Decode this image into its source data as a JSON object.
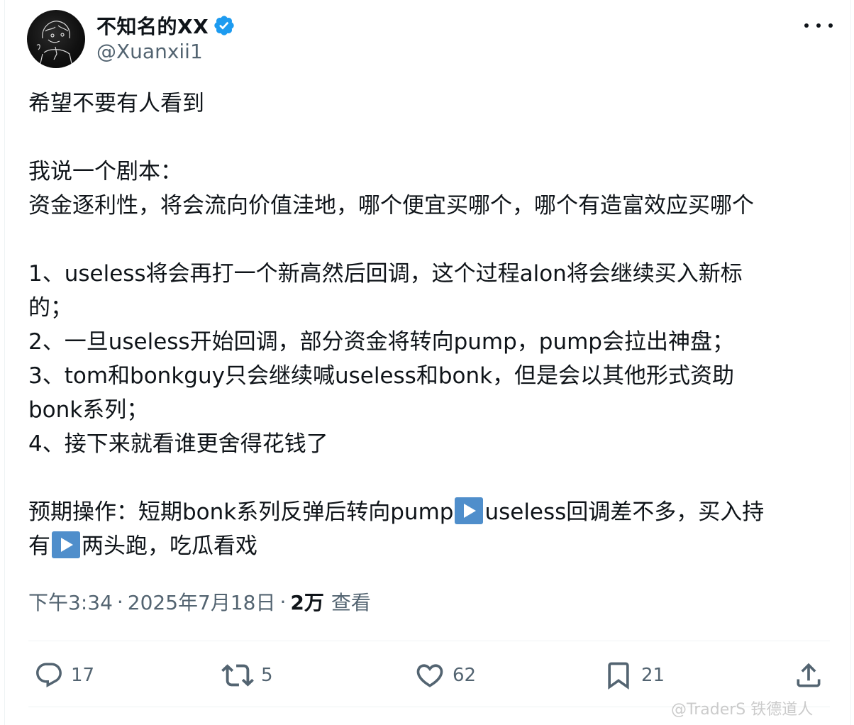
{
  "author": {
    "display_name": "不知名的XX",
    "handle": "@Xuanxii1",
    "verified": true
  },
  "tweet": {
    "lines": [
      "希望不要有人看到",
      "",
      "我说一个剧本：",
      "资金逐利性，将会流向价值洼地，哪个便宜买哪个，哪个有造富效应买哪个",
      "",
      "1、useless将会再打一个新高然后回调，这个过程alon将会继续买入新标",
      "的；",
      "2、一旦useless开始回调，部分资金将转向pump，pump会拉出神盘；",
      "3、tom和bonkguy只会继续喊useless和bonk，但是会以其他形式资助",
      "bonk系列；",
      "4、接下来就看谁更舍得花钱了",
      ""
    ],
    "plan_line1_a": "预期操作：短期bonk系列反弹后转向pump",
    "plan_line1_b": "useless回调差不多，买入持",
    "plan_line2_a": "有",
    "plan_line2_b": "两头跑，吃瓜看戏"
  },
  "meta": {
    "time": "下午3:34",
    "date": "2025年7月18日",
    "separator": "·",
    "views_count": "2万",
    "views_label": "查看"
  },
  "actions": {
    "replies": "17",
    "reposts": "5",
    "likes": "62",
    "bookmarks": "21"
  },
  "watermark": "@TraderS 铁德道人",
  "icons": {
    "verified": "verified-badge-icon",
    "more": "more-dots-icon",
    "reply": "reply-icon",
    "repost": "repost-icon",
    "like": "heart-icon",
    "bookmark": "bookmark-icon",
    "share": "share-icon",
    "emoji": "play-button-emoji"
  },
  "colors": {
    "verified_blue": "#1d9bf0",
    "text": "#0f1419",
    "secondary": "#536471",
    "emoji_blue": "#4f8ecb"
  }
}
